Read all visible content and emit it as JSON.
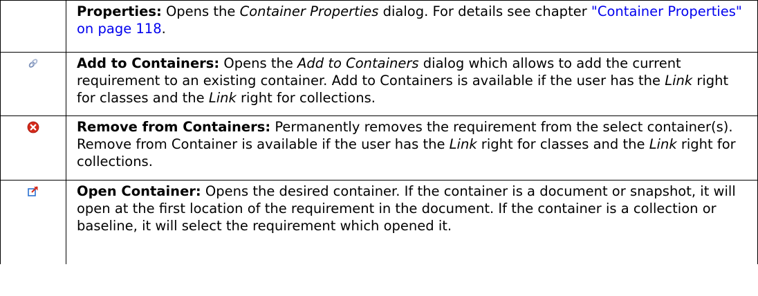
{
  "rows": [
    {
      "icon": "",
      "segments": [
        {
          "text": "Properties:",
          "style": "bold"
        },
        {
          "text": " Opens the ",
          "style": ""
        },
        {
          "text": "Container Properties",
          "style": "italic"
        },
        {
          "text": " dialog. For details see chapter ",
          "style": ""
        },
        {
          "text": "\"Container Properties\" on page 118",
          "style": "link"
        },
        {
          "text": ".",
          "style": ""
        }
      ]
    },
    {
      "icon": "link-chain-icon",
      "segments": [
        {
          "text": "Add to Containers:",
          "style": "bold"
        },
        {
          "text": " Opens the ",
          "style": ""
        },
        {
          "text": "Add to Containers",
          "style": "italic"
        },
        {
          "text": " dialog which allows to add the current requirement to an existing container. Add to Containers is available if the user has the ",
          "style": ""
        },
        {
          "text": "Link",
          "style": "italic"
        },
        {
          "text": " right for classes and the ",
          "style": ""
        },
        {
          "text": "Link",
          "style": "italic"
        },
        {
          "text": " right for collections.",
          "style": ""
        }
      ]
    },
    {
      "icon": "remove-red-x-icon",
      "segments": [
        {
          "text": "Remove from Containers:",
          "style": "bold"
        },
        {
          "text": " Permanently removes the requirement from the select container(s). Remove from Container is available if the user has the ",
          "style": ""
        },
        {
          "text": "Link",
          "style": "italic"
        },
        {
          "text": " right for classes and the ",
          "style": ""
        },
        {
          "text": "Link",
          "style": "italic"
        },
        {
          "text": " right for collections.",
          "style": ""
        }
      ]
    },
    {
      "icon": "open-external-icon",
      "segments": [
        {
          "text": "Open Container:",
          "style": "bold"
        },
        {
          "text": " Opens the desired container. If the container is a document or snapshot, it will open at the first location of the requirement in the document. If the container is a collection or baseline, it will select the requirement which opened it.",
          "style": ""
        }
      ]
    }
  ],
  "colors": {
    "link": "#0000ee",
    "remove_icon": "#d42a1a",
    "open_icon": "#2a6fd0",
    "chain_icon": "#7a8fb8"
  }
}
